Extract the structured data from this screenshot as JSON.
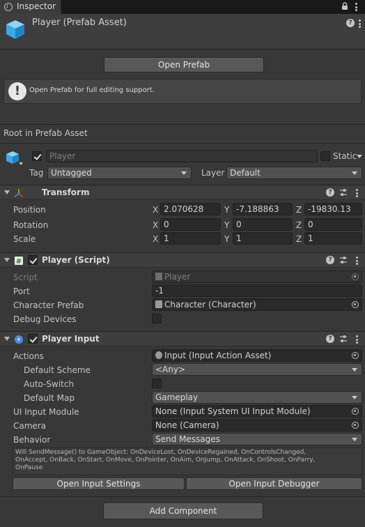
{
  "tab": {
    "title": "Inspector"
  },
  "header": {
    "title": "Player (Prefab Asset)"
  },
  "open_prefab": {
    "label": "Open Prefab"
  },
  "helpbox": {
    "text": "Open Prefab for full editing support."
  },
  "root_label": "Root in Prefab Asset",
  "gameobject": {
    "name": "Player",
    "static_label": "Static",
    "tag_label": "Tag",
    "tag_value": "Untagged",
    "layer_label": "Layer",
    "layer_value": "Default"
  },
  "transform": {
    "title": "Transform",
    "rows": [
      {
        "label": "Position",
        "x": "2.070628",
        "y": "-7.188863",
        "z": "-19830.13"
      },
      {
        "label": "Rotation",
        "x": "0",
        "y": "0",
        "z": "0"
      },
      {
        "label": "Scale",
        "x": "1",
        "y": "1",
        "z": "1"
      }
    ],
    "axes": [
      "X",
      "Y",
      "Z"
    ]
  },
  "player_script": {
    "title": "Player (Script)",
    "script_label": "Script",
    "script_value": "Player",
    "port_label": "Port",
    "port_value": "-1",
    "char_label": "Character Prefab",
    "char_value": "Character (Character)",
    "debug_label": "Debug Devices"
  },
  "player_input": {
    "title": "Player Input",
    "actions_label": "Actions",
    "actions_value": "Input (Input Action Asset)",
    "scheme_label": "Default Scheme",
    "scheme_value": "<Any>",
    "autoswitch_label": "Auto-Switch",
    "map_label": "Default Map",
    "map_value": "Gameplay",
    "uimodule_label": "UI Input Module",
    "uimodule_value": "None (Input System UI Input Module)",
    "camera_label": "Camera",
    "camera_value": "None (Camera)",
    "behavior_label": "Behavior",
    "behavior_value": "Send Messages",
    "info_lines": [
      "Will SendMessage() to GameObject: OnDeviceLost, OnDeviceRegained, OnControlsChanged,",
      "OnAccept, OnBack, OnStart, OnMove, OnPointer, OnAim, OnJump, OnAttack, OnShoot, OnParry,",
      "OnPause"
    ],
    "open_settings_label": "Open Input Settings",
    "open_debugger_label": "Open Input Debugger"
  },
  "add_component": {
    "label": "Add Component"
  },
  "colors": {
    "background": "#383838",
    "field": "#2a2a2a",
    "button": "#585858",
    "text": "#c4c4c4"
  },
  "icons": [
    "info-icon",
    "lock-icon",
    "kebab-menu-icon",
    "prefab-cube-icon",
    "help-icon",
    "preset-icon",
    "transform-icon",
    "script-icon",
    "player-input-icon",
    "object-picker-icon",
    "warning-icon"
  ]
}
